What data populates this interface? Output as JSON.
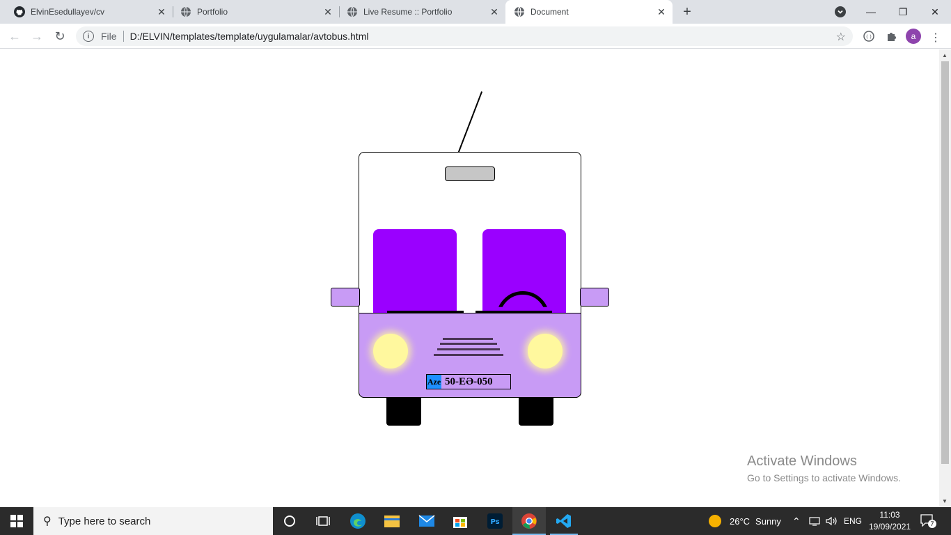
{
  "browser": {
    "tabs": [
      {
        "title": "ElvinEsedullayev/cv",
        "icon": "github-icon",
        "active": false
      },
      {
        "title": "Portfolio",
        "icon": "globe-icon",
        "active": false
      },
      {
        "title": "Live Resume :: Portfolio",
        "icon": "globe-icon",
        "active": false
      },
      {
        "title": "Document",
        "icon": "globe-icon",
        "active": true
      }
    ],
    "address": {
      "scheme_label": "File",
      "url": "D:/ELVIN/templates/template/uygulamalar/avtobus.html"
    },
    "profile_initial": "a"
  },
  "page": {
    "bus": {
      "body_color": "#ffffff",
      "window_color": "#9a00ff",
      "front_color": "#c89bf5",
      "headlight_color": "#fff89e",
      "plate": {
        "country": "Aze",
        "number": "50-EƏ-050"
      }
    },
    "watermark": {
      "title": "Activate Windows",
      "subtitle": "Go to Settings to activate Windows."
    }
  },
  "taskbar": {
    "search_placeholder": "Type here to search",
    "weather": {
      "temp": "26°C",
      "condition": "Sunny"
    },
    "language": "ENG",
    "time": "11:03",
    "date": "19/09/2021",
    "notification_count": "7"
  }
}
